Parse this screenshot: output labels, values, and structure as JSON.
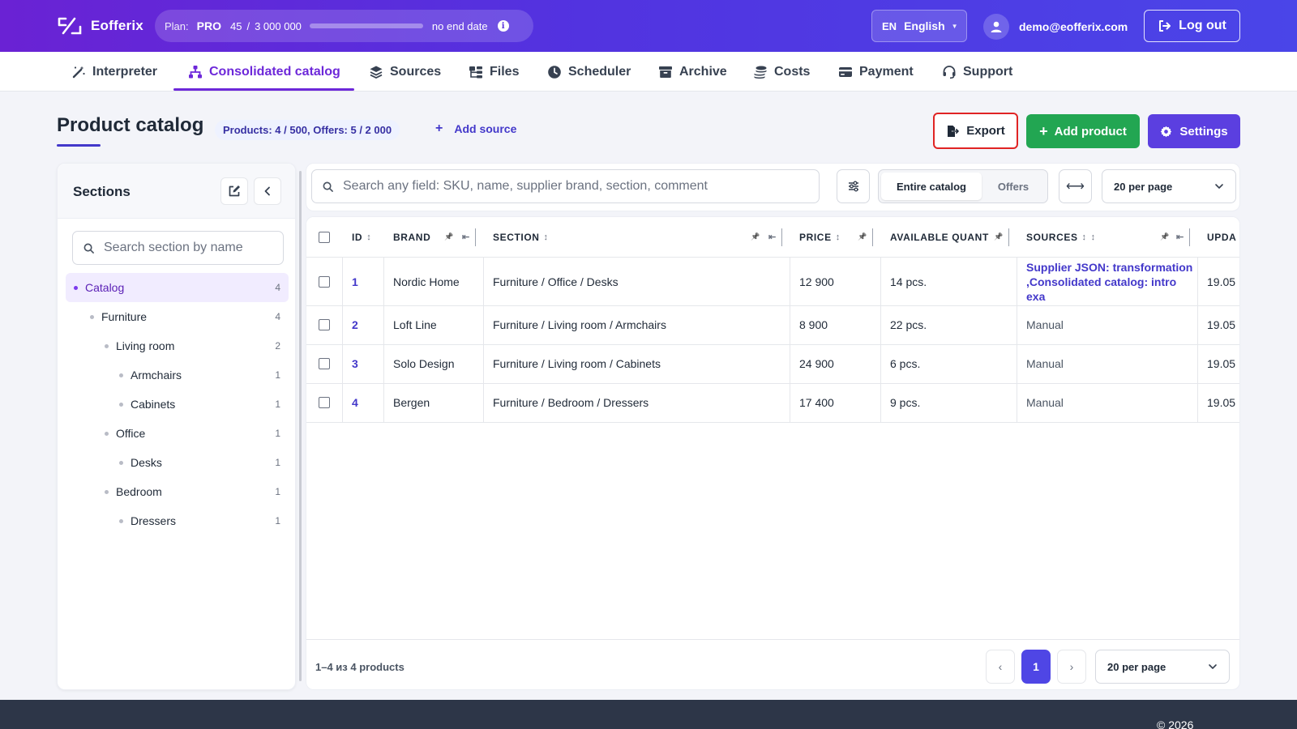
{
  "app": {
    "name": "Eofferix",
    "plan": {
      "label": "Plan:",
      "name": "PRO",
      "used": "45",
      "separator": "/",
      "limit": "3 000 000",
      "usage_fraction": 1.5e-05,
      "end": "no end date"
    },
    "language": {
      "code": "EN",
      "name": "English"
    },
    "user_email": "demo@eofferix.com",
    "logout_label": "Log out"
  },
  "nav": [
    {
      "label": "Interpreter",
      "icon": "magic-wand-icon"
    },
    {
      "label": "Consolidated catalog",
      "icon": "sitemap-icon",
      "active": true
    },
    {
      "label": "Sources",
      "icon": "layers-icon"
    },
    {
      "label": "Files",
      "icon": "folder-tree-icon"
    },
    {
      "label": "Scheduler",
      "icon": "clock-icon"
    },
    {
      "label": "Archive",
      "icon": "archive-box-icon"
    },
    {
      "label": "Costs",
      "icon": "coins-icon"
    },
    {
      "label": "Payment",
      "icon": "credit-card-icon"
    },
    {
      "label": "Support",
      "icon": "headset-icon"
    }
  ],
  "page": {
    "title": "Product catalog",
    "counts": "Products: 4 / 500, Offers: 5 / 2 000",
    "add_source": "Add source",
    "export": "Export",
    "add_product": "Add product",
    "settings": "Settings"
  },
  "sidebar": {
    "title": "Sections",
    "search_placeholder": "Search section by name",
    "tree": [
      {
        "label": "Catalog",
        "count": "4",
        "level": 0,
        "selected": true
      },
      {
        "label": "Furniture",
        "count": "4",
        "level": 1
      },
      {
        "label": "Living room",
        "count": "2",
        "level": 2
      },
      {
        "label": "Armchairs",
        "count": "1",
        "level": 3
      },
      {
        "label": "Cabinets",
        "count": "1",
        "level": 3
      },
      {
        "label": "Office",
        "count": "1",
        "level": 2
      },
      {
        "label": "Desks",
        "count": "1",
        "level": 3
      },
      {
        "label": "Bedroom",
        "count": "1",
        "level": 2
      },
      {
        "label": "Dressers",
        "count": "1",
        "level": 3
      }
    ]
  },
  "toolbar": {
    "search_placeholder": "Search any field: SKU, name, supplier brand, section, comment",
    "scope_options": [
      "Entire catalog",
      "Offers"
    ],
    "per_page": "20 per page"
  },
  "table": {
    "columns": [
      "ID",
      "BRAND",
      "SECTION",
      "PRICE",
      "AVAILABLE QUANT",
      "SOURCES",
      "UPDA"
    ],
    "rows": [
      {
        "id": "1",
        "brand": "Nordic Home",
        "section": "Furniture / Office / Desks",
        "price": "12 900",
        "qty": "14 pcs.",
        "sources": "Supplier JSON: transformation ,Consolidated catalog: intro exa",
        "sources_link": true,
        "updated": "19.05"
      },
      {
        "id": "2",
        "brand": "Loft Line",
        "section": "Furniture / Living room / Armchairs",
        "price": "8 900",
        "qty": "22 pcs.",
        "sources": "Manual",
        "sources_link": false,
        "updated": "19.05"
      },
      {
        "id": "3",
        "brand": "Solo Design",
        "section": "Furniture / Living room / Cabinets",
        "price": "24 900",
        "qty": "6 pcs.",
        "sources": "Manual",
        "sources_link": false,
        "updated": "19.05"
      },
      {
        "id": "4",
        "brand": "Bergen",
        "section": "Furniture / Bedroom / Dressers",
        "price": "17 400",
        "qty": "9 pcs.",
        "sources": "Manual",
        "sources_link": false,
        "updated": "19.05"
      }
    ],
    "footer_count": "1–4 из 4 products",
    "prev": "‹",
    "current_page": "1",
    "next": "›",
    "per_page": "20 per page"
  },
  "footer": {
    "copyright": "© 2026"
  }
}
